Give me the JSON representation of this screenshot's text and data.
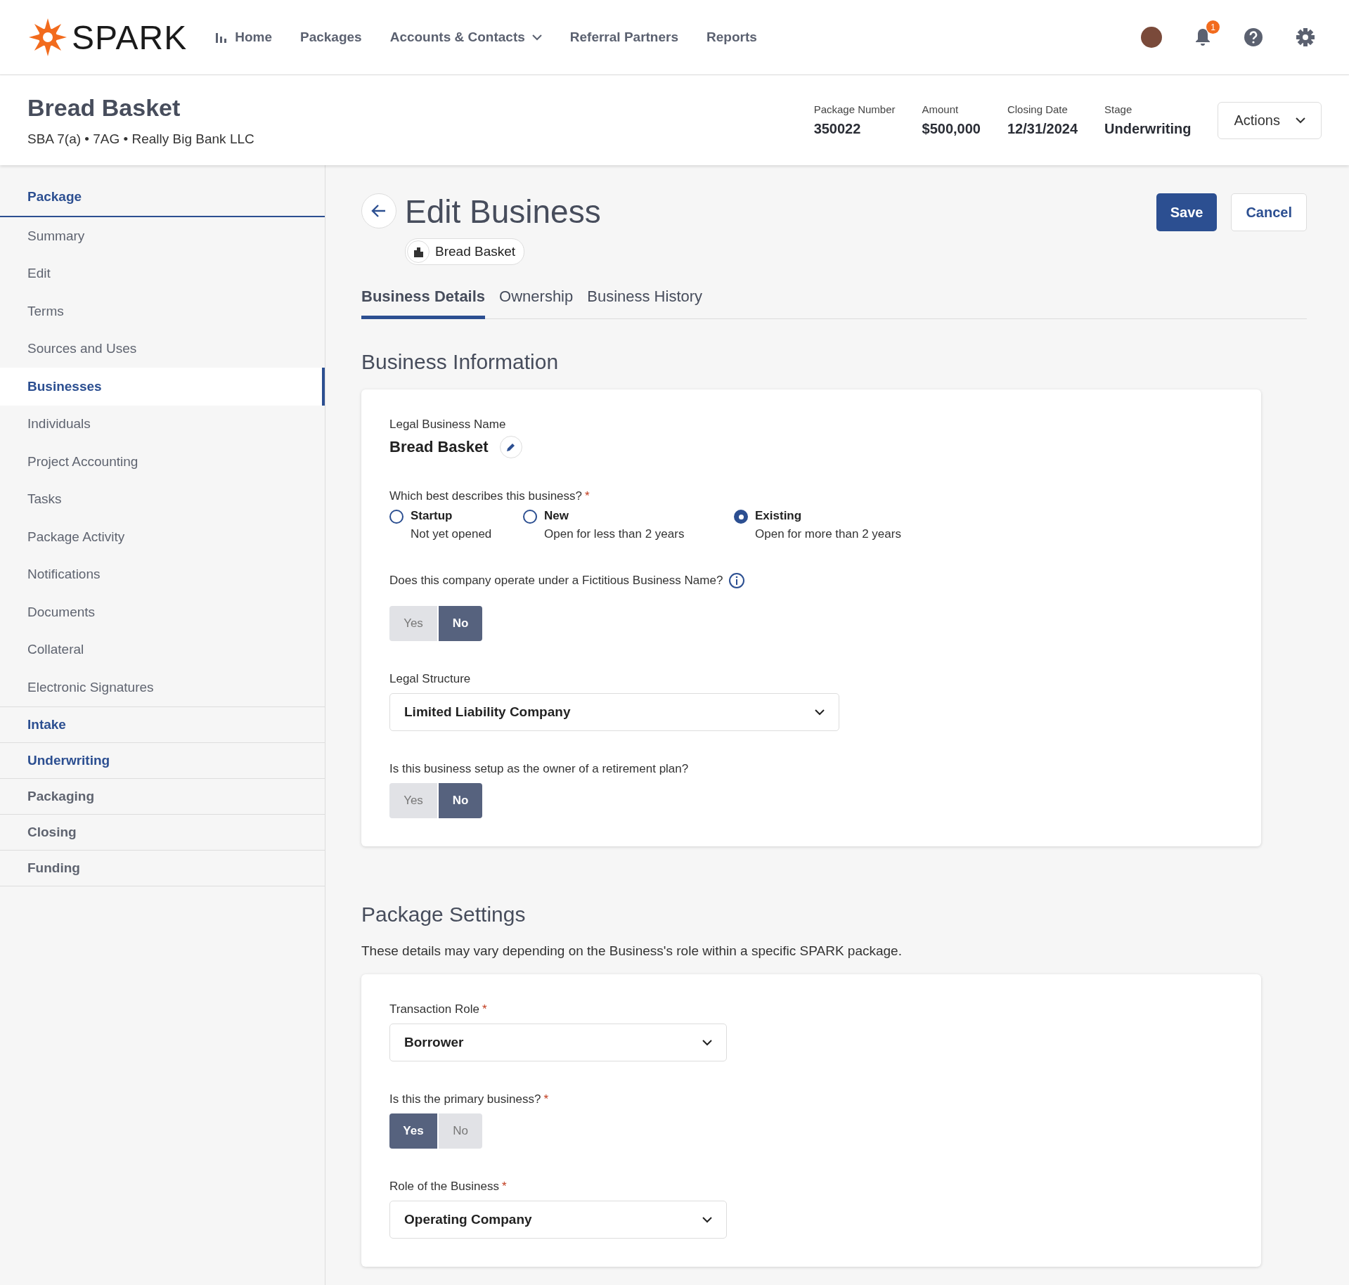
{
  "nav": {
    "logo": "SPARK",
    "items": [
      {
        "label": "Home",
        "dropdown": false
      },
      {
        "label": "Packages",
        "dropdown": false
      },
      {
        "label": "Accounts & Contacts",
        "dropdown": true
      },
      {
        "label": "Referral Partners",
        "dropdown": false
      },
      {
        "label": "Reports",
        "dropdown": false
      }
    ],
    "notification_count": "1"
  },
  "header": {
    "title": "Bread Basket",
    "subtitle": "SBA 7(a) • 7AG • Really Big Bank LLC",
    "facts": [
      {
        "label": "Package Number",
        "value": "350022"
      },
      {
        "label": "Amount",
        "value": "$500,000"
      },
      {
        "label": "Closing Date",
        "value": "12/31/2024"
      },
      {
        "label": "Stage",
        "value": "Underwriting"
      }
    ],
    "actions": "Actions"
  },
  "sidebar": {
    "sections": [
      {
        "label": "Package",
        "disabled": false,
        "items": [
          {
            "label": "Summary",
            "selected": false
          },
          {
            "label": "Edit",
            "selected": false
          },
          {
            "label": "Terms",
            "selected": false
          },
          {
            "label": "Sources and Uses",
            "selected": false
          },
          {
            "label": "Businesses",
            "selected": true
          },
          {
            "label": "Individuals",
            "selected": false
          },
          {
            "label": "Project Accounting",
            "selected": false
          },
          {
            "label": "Tasks",
            "selected": false
          },
          {
            "label": "Package Activity",
            "selected": false
          },
          {
            "label": "Notifications",
            "selected": false
          },
          {
            "label": "Documents",
            "selected": false
          },
          {
            "label": "Collateral",
            "selected": false
          },
          {
            "label": "Electronic Signatures",
            "selected": false
          }
        ]
      },
      {
        "label": "Intake",
        "disabled": false
      },
      {
        "label": "Underwriting",
        "disabled": false
      },
      {
        "label": "Packaging",
        "disabled": true
      },
      {
        "label": "Closing",
        "disabled": true
      },
      {
        "label": "Funding",
        "disabled": true
      }
    ]
  },
  "page": {
    "title": "Edit Business",
    "chip": "Bread Basket",
    "save": "Save",
    "cancel": "Cancel",
    "tabs": [
      {
        "label": "Business Details",
        "selected": true
      },
      {
        "label": "Ownership",
        "selected": false
      },
      {
        "label": "Business History",
        "selected": false
      }
    ]
  },
  "business_information": {
    "heading": "Business Information",
    "fields": [
      {
        "kind": "name",
        "label": "Legal Business Name",
        "value": "Bread Basket"
      },
      {
        "kind": "radio",
        "label": "Which best describes this business?",
        "required_mark": "*",
        "options": [
          {
            "label": "Startup",
            "hint": "Not yet opened",
            "selected": false
          },
          {
            "label": "New",
            "hint": "Open for less than 2 years",
            "selected": false
          },
          {
            "label": "Existing",
            "hint": "Open for more than 2 years",
            "selected": true
          }
        ]
      },
      {
        "kind": "toggle",
        "label": "Does this company operate under a Fictitious Business Name?",
        "info": true,
        "options": [
          {
            "label": "Yes",
            "selected": false
          },
          {
            "label": "No",
            "selected": true
          }
        ]
      },
      {
        "kind": "select",
        "label": "Legal Structure",
        "value": "Limited Liability Company",
        "wide": true
      },
      {
        "kind": "toggle",
        "label": "Is this business setup as the owner of a retirement plan?",
        "options": [
          {
            "label": "Yes",
            "selected": false
          },
          {
            "label": "No",
            "selected": true
          }
        ]
      }
    ]
  },
  "package_settings": {
    "heading": "Package Settings",
    "description": "These details may vary depending on the Business's role within a specific SPARK package.",
    "fields": [
      {
        "kind": "select",
        "label": "Transaction Role",
        "required_mark": "*",
        "value": "Borrower",
        "wide": false
      },
      {
        "kind": "toggle",
        "label": "Is this the primary business?",
        "required_mark": "*",
        "options": [
          {
            "label": "Yes",
            "selected": true
          },
          {
            "label": "No",
            "selected": false
          }
        ]
      },
      {
        "kind": "select",
        "label": "Role of the Business",
        "required_mark": "*",
        "value": "Operating Company",
        "wide": false
      }
    ]
  }
}
